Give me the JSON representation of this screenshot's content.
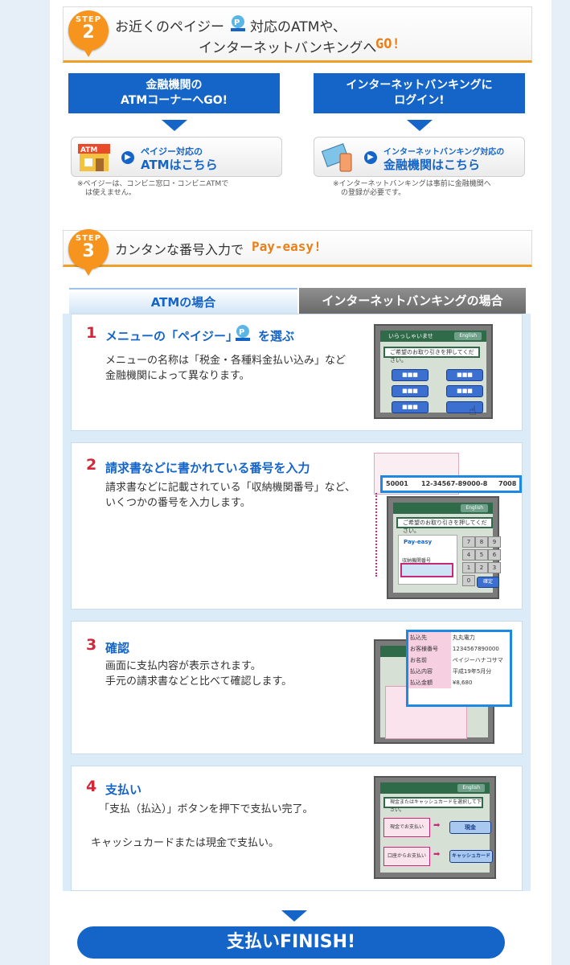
{
  "step2": {
    "badge_label": "STEP",
    "badge_num": "2",
    "title_line1": "お近くのペイジー",
    "title_line1b": "対応のATMや、",
    "title_line2": "インターネットバンキングへ",
    "title_go": "GO!",
    "atm_box": {
      "line1": "金融機関の",
      "line2": "ATMコーナーへGO!"
    },
    "ib_box": {
      "line1": "インターネットバンキングに",
      "line2": "ログイン!"
    },
    "atm_link": {
      "sub": "ペイジー対応の",
      "main": "ATMはこちら",
      "icon_text": "ATM"
    },
    "ib_link": {
      "sub": "インターネットバンキング対応の",
      "main": "金融機関はこちら"
    },
    "atm_note": [
      "※ペイジーは、コンビニ窓口・コンビニATMで",
      "は使えません。"
    ],
    "ib_note": [
      "※インターネットバンキングは事前に金融機関へ",
      "の登録が必要です。"
    ]
  },
  "step3": {
    "badge_label": "STEP",
    "badge_num": "3",
    "title": "カンタンな番号入力で",
    "title_highlight": "Pay-easy!"
  },
  "tabs": {
    "atm": "ATMの場合",
    "ib": "インターネットバンキングの場合"
  },
  "steps": [
    {
      "num": "1",
      "title_a": "メニューの「ペイジー」",
      "title_b": "を選ぶ",
      "desc": [
        "メニューの名称は「税金・各種料金払い込み」など",
        "金融機関によって異なります。"
      ]
    },
    {
      "num": "2",
      "title": "請求書などに書かれている番号を入力",
      "desc": [
        "請求書などに記載されている「収納機関番号」など、",
        "いくつかの番号を入力します。"
      ]
    },
    {
      "num": "3",
      "title": "確認",
      "desc": [
        "画面に支払内容が表示されます。",
        "手元の請求書などと比べて確認します。"
      ]
    },
    {
      "num": "4",
      "title": "支払い",
      "desc1": "「支払（払込）」ボタンを押下で支払い完了。",
      "desc2": "キャッシュカードまたは現金で支払い。"
    }
  ],
  "screens": {
    "header": "いらっしゃいませ",
    "english": "English",
    "msg1": "ご希望のお取り引きを押してください。",
    "msg4": "現金またはキャッシュカードを選択して下さい。",
    "btn": "■■■",
    "payeasy_logo": "Pay-easy",
    "field_label": "収納機関番号",
    "keys": [
      "7",
      "8",
      "9",
      "4",
      "5",
      "6",
      "1",
      "2",
      "3",
      "0"
    ],
    "confirm_key": "確定",
    "number_strip": {
      "a": "50001",
      "b": "12-34567-89000-8",
      "c": "7008"
    },
    "confirm_rows": [
      {
        "k": "払込先",
        "v": "丸丸電力"
      },
      {
        "k": "お客様番号",
        "v": "1234567890000"
      },
      {
        "k": "お名前",
        "v": "ペイジーハナコサマ"
      },
      {
        "k": "払込内容",
        "v": "平成19年5月分"
      },
      {
        "k": "払込金額",
        "v": "¥8,680"
      }
    ],
    "pay_rows": [
      {
        "k": "現金でお支払い",
        "v": "現金"
      },
      {
        "k": "口座からお支払い",
        "v": "キャッシュカード"
      }
    ]
  },
  "finish": "支払いFINISH!"
}
